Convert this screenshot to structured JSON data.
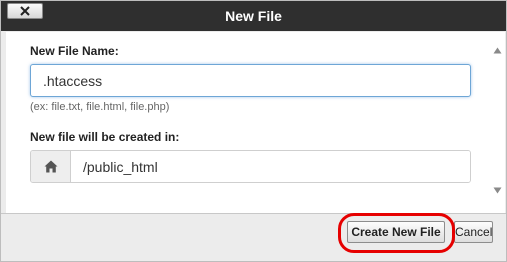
{
  "dialog": {
    "title": "New File",
    "close_icon": "close-x-icon"
  },
  "form": {
    "filename_label": "New File Name:",
    "filename_value": ".htaccess",
    "filename_hint": "(ex: file.txt, file.html, file.php)",
    "location_label": "New file will be created in:",
    "location_icon": "home-icon",
    "location_value": "/public_html"
  },
  "footer": {
    "create_label": "Create New File",
    "cancel_label": "Cancel"
  },
  "colors": {
    "titlebar": "#2f2f2f",
    "highlight": "#e60000",
    "input_focus": "#6ea6d6"
  }
}
